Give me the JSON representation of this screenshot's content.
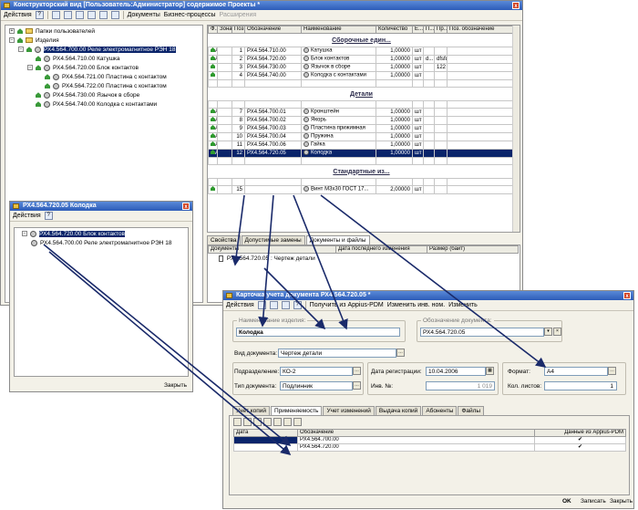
{
  "main_window": {
    "title": "Конструкторский вид [Пользователь:Администратор] содержимое  Проекты *",
    "toolbar": {
      "actions": "Действия",
      "documents": "Документы",
      "business": "Бизнес-процессы",
      "extensions": "Расширения",
      "help": "?"
    },
    "tree": [
      {
        "label": "Папки пользователей",
        "level": 0,
        "icon": "folder-icon",
        "expand": "+"
      },
      {
        "label": "Изделия",
        "level": 0,
        "icon": "folder-icon",
        "expand": "−"
      },
      {
        "label": "РХ4.564.700.00 Реле электромагнитное РЭН 18",
        "level": 1,
        "icon": "gear-icon",
        "expand": "−",
        "selected": true
      },
      {
        "label": "РХ4.564.710.00 Катушка",
        "level": 2,
        "icon": "gear-icon",
        "expand": ""
      },
      {
        "label": "РХ4.564.720.00 Блок контактов",
        "level": 2,
        "icon": "gear-icon",
        "expand": "−"
      },
      {
        "label": "РХ4.564.721.00 Пластина с контактом",
        "level": 3,
        "icon": "gear-icon",
        "expand": ""
      },
      {
        "label": "РХ4.564.722.00 Пластина с контактом",
        "level": 3,
        "icon": "gear-icon",
        "expand": ""
      },
      {
        "label": "РХ4.564.730.00 Язычок в сборе",
        "level": 2,
        "icon": "gear-icon",
        "expand": ""
      },
      {
        "label": "РХ4.564.740.00 Колодка с контактами",
        "level": 2,
        "icon": "gear-icon",
        "expand": ""
      }
    ],
    "table": {
      "headers": [
        "Ф...",
        "Зона",
        "Поз...",
        "Обозначение",
        "Наименование",
        "Количество",
        "Е...",
        "П...",
        "Пр...",
        "Поз. обозначение"
      ],
      "rows": [
        {
          "group": "Сборочные един..."
        },
        {
          "cells": [
            "А...",
            "",
            "1",
            "РХ4.564.710.00",
            "Катушка",
            "1,00000",
            "шт",
            "",
            "",
            ""
          ]
        },
        {
          "cells": [
            "А4",
            "",
            "2",
            "РХ4.564.720.00",
            "Блок контактов",
            "1,00000",
            "шт",
            "d...",
            "dfsfdfs",
            ""
          ]
        },
        {
          "cells": [
            "",
            "",
            "3",
            "РХ4.564.730.00",
            "Язычок в сборе",
            "1,00000",
            "шт",
            "",
            "122",
            ""
          ]
        },
        {
          "cells": [
            "",
            "",
            "4",
            "РХ4.564.740.00",
            "Колодка с контактами",
            "1,00000",
            "шт",
            "",
            "",
            ""
          ]
        },
        {
          "blank": true
        },
        {
          "group": "Детали"
        },
        {
          "blank": true
        },
        {
          "cells": [
            "А3",
            "",
            "7",
            "РХ4.564.700.01",
            "Кронштейн",
            "1,00000",
            "шт",
            "",
            "",
            ""
          ]
        },
        {
          "cells": [
            "А3",
            "",
            "8",
            "РХ4.564.700.02",
            "Якорь",
            "1,00000",
            "шт",
            "",
            "",
            ""
          ]
        },
        {
          "cells": [
            "А4",
            "",
            "9",
            "РХ4.564.700.03",
            "Пластина прижимная",
            "1,00000",
            "шт",
            "",
            "",
            ""
          ]
        },
        {
          "cells": [
            "А4",
            "",
            "10",
            "РХ4.564.700.04",
            "Пружина",
            "1,00000",
            "шт",
            "",
            "",
            ""
          ]
        },
        {
          "cells": [
            "А4",
            "",
            "11",
            "РХ4.564.700.06",
            "Гайка",
            "1,00000",
            "шт",
            "",
            "",
            ""
          ]
        },
        {
          "cells": [
            "А4",
            "",
            "12",
            "РХ4.564.720.05",
            "Колодка",
            "1,00000",
            "шт",
            "",
            "",
            ""
          ],
          "selected": true
        },
        {
          "blank": true
        },
        {
          "group": "Стандартные из..."
        },
        {
          "blank": true
        },
        {
          "cells": [
            "",
            "",
            "15",
            "",
            "Винт М3х30 ГОСТ 17...",
            "2,00000",
            "шт",
            "",
            "",
            ""
          ]
        }
      ]
    },
    "bottom_tabs": [
      "Свойства",
      "Допустимые замены",
      "Документы и файлы"
    ],
    "docs": {
      "headers": [
        "Документы",
        "Дата последнего изменения",
        "Размер (байт)"
      ],
      "row": "РХ4.564.720.05 : Чертеж детали"
    }
  },
  "small_window": {
    "title": "РХ4.564.720.05 Колодка",
    "actions": "Действия",
    "help": "?",
    "items": [
      "РХ4.564.720.00 Блок контактов",
      "РХ4.564.700.00 Реле электромагнитное РЭН 18"
    ],
    "close": "Закрыть"
  },
  "card_window": {
    "title": "Карточка учета документа РХ4.564.720.05 *",
    "toolbar": {
      "actions": "Действия",
      "get": "Получить из Appius-PDM",
      "change_inv": "Изменить инв. ном.",
      "change": "Изменить",
      "help": "?"
    },
    "product_name_label": "Наименование изделия:",
    "product_name": "Колодка",
    "designation_label": "Обозначение документа:",
    "designation": "РХ4.564.720.05",
    "doc_type_label": "Вид документа:",
    "doc_type": "Чертеж детали",
    "division_label": "Подразделение:",
    "division": "КО-2",
    "doc_kind_label": "Тип документа:",
    "doc_kind": "Подлинник",
    "reg_date_label": "Дата регистрации:",
    "reg_date": "10.04.2006",
    "inv_label": "Инв. №:",
    "inv": "1 019",
    "format_label": "Формат:",
    "format": "А4",
    "sheets_label": "Кол. листов:",
    "sheets": "1",
    "tabs": [
      "Учет копий",
      "Применяемость",
      "Учет изменений",
      "Выдача копий",
      "Абоненты",
      "Файлы"
    ],
    "grid": {
      "headers": [
        "Дата",
        "Обозначение",
        "Данные из Appius-PDM"
      ],
      "rows": [
        [
          "",
          "РХ4.564.700.00",
          "✔"
        ],
        [
          "",
          "РХ4.564.720.00",
          "✔"
        ]
      ]
    },
    "footer": {
      "ok": "OK",
      "save": "Записать",
      "close": "Закрыть"
    }
  },
  "colors": {
    "title_bar": "#2d5cb8",
    "selection": "#0a246a",
    "window_bg": "#f3f1e8",
    "group_text": "#2a2a4a"
  }
}
